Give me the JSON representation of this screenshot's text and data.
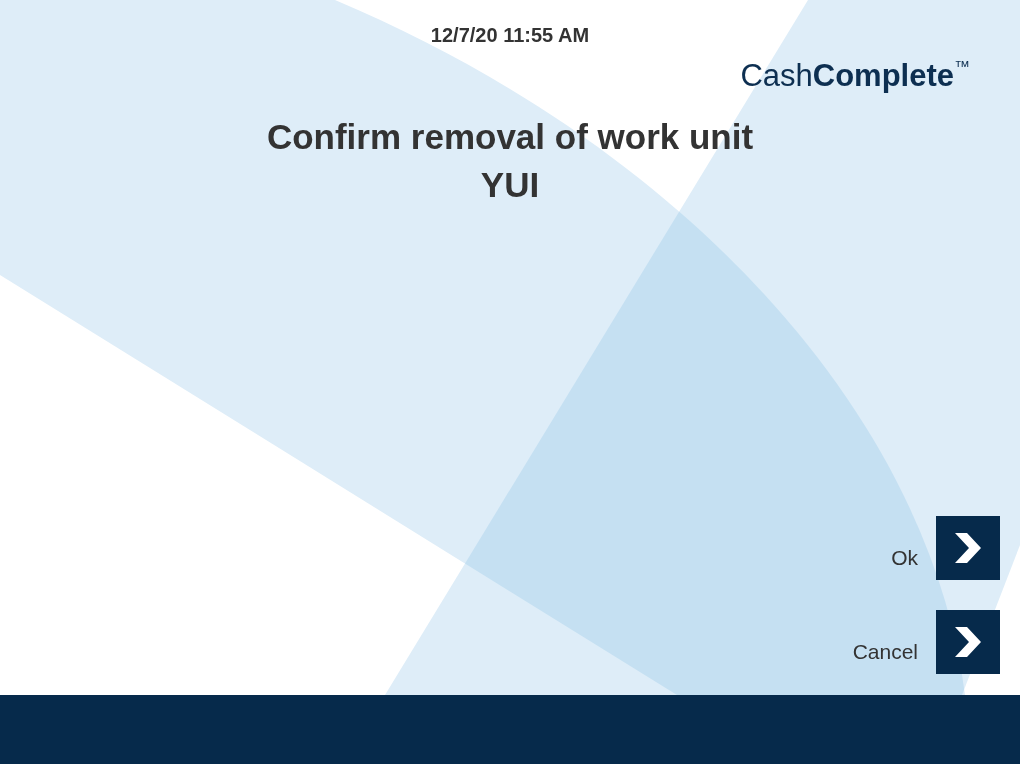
{
  "header": {
    "datetime": "12/7/20 11:55 AM"
  },
  "logo": {
    "light_text": "Cash",
    "bold_text": "Complete",
    "trademark": "™"
  },
  "message": {
    "lines": [
      "Confirm removal of work unit",
      "YUI"
    ]
  },
  "buttons": [
    {
      "label": "Ok"
    },
    {
      "label": "Cancel"
    }
  ]
}
